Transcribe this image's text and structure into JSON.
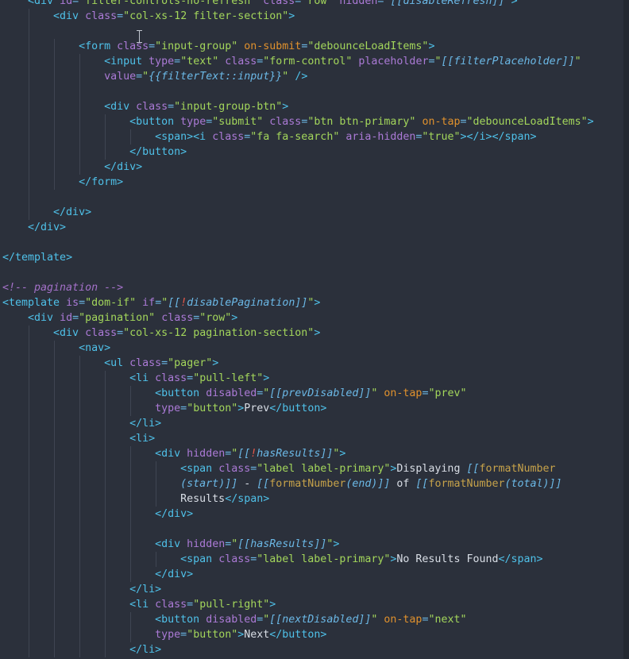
{
  "editor": {
    "lines": [
      [
        [
          "t",
          "    <div"
        ],
        [
          "w",
          " "
        ],
        [
          "a",
          "id"
        ],
        [
          "p",
          "="
        ],
        [
          "s",
          "\"filter-controls-no-refresh\""
        ],
        [
          "w",
          " "
        ],
        [
          "a",
          "class"
        ],
        [
          "p",
          "="
        ],
        [
          "s",
          "\"row\""
        ],
        [
          "w",
          " "
        ],
        [
          "a",
          "hidden"
        ],
        [
          "p",
          "="
        ],
        [
          "s",
          "\""
        ],
        [
          "i",
          "[[disableRefresh]]"
        ],
        [
          "s",
          "\""
        ],
        [
          "t",
          ">"
        ]
      ],
      [
        [
          "t",
          "        <div"
        ],
        [
          "w",
          " "
        ],
        [
          "a",
          "class"
        ],
        [
          "p",
          "="
        ],
        [
          "s",
          "\"col-xs-12 filter-section\""
        ],
        [
          "t",
          ">"
        ]
      ],
      [],
      [
        [
          "t",
          "            <form"
        ],
        [
          "w",
          " "
        ],
        [
          "a",
          "class"
        ],
        [
          "p",
          "="
        ],
        [
          "s",
          "\"input-group\""
        ],
        [
          "w",
          " "
        ],
        [
          "o",
          "on-submit"
        ],
        [
          "p",
          "="
        ],
        [
          "s",
          "\"debounceLoadItems\""
        ],
        [
          "t",
          ">"
        ]
      ],
      [
        [
          "t",
          "                <input"
        ],
        [
          "w",
          " "
        ],
        [
          "a",
          "type"
        ],
        [
          "p",
          "="
        ],
        [
          "s",
          "\"text\""
        ],
        [
          "w",
          " "
        ],
        [
          "a",
          "class"
        ],
        [
          "p",
          "="
        ],
        [
          "s",
          "\"form-control\""
        ],
        [
          "w",
          " "
        ],
        [
          "a",
          "placeholder"
        ],
        [
          "p",
          "="
        ],
        [
          "s",
          "\""
        ],
        [
          "i",
          "[[filterPlaceholder]]"
        ],
        [
          "s",
          "\""
        ]
      ],
      [
        [
          "w",
          "                "
        ],
        [
          "a",
          "value"
        ],
        [
          "p",
          "="
        ],
        [
          "s",
          "\""
        ],
        [
          "i",
          "{{filterText::input}}"
        ],
        [
          "s",
          "\""
        ],
        [
          "w",
          " "
        ],
        [
          "t",
          "/>"
        ]
      ],
      [],
      [
        [
          "t",
          "                <div"
        ],
        [
          "w",
          " "
        ],
        [
          "a",
          "class"
        ],
        [
          "p",
          "="
        ],
        [
          "s",
          "\"input-group-btn\""
        ],
        [
          "t",
          ">"
        ]
      ],
      [
        [
          "t",
          "                    <button"
        ],
        [
          "w",
          " "
        ],
        [
          "a",
          "type"
        ],
        [
          "p",
          "="
        ],
        [
          "s",
          "\"submit\""
        ],
        [
          "w",
          " "
        ],
        [
          "a",
          "class"
        ],
        [
          "p",
          "="
        ],
        [
          "s",
          "\"btn btn-primary\""
        ],
        [
          "w",
          " "
        ],
        [
          "o",
          "on-tap"
        ],
        [
          "p",
          "="
        ],
        [
          "s",
          "\"debounceLoadItems\""
        ],
        [
          "t",
          ">"
        ]
      ],
      [
        [
          "t",
          "                        <span><i"
        ],
        [
          "w",
          " "
        ],
        [
          "a",
          "class"
        ],
        [
          "p",
          "="
        ],
        [
          "s",
          "\"fa fa-search\""
        ],
        [
          "w",
          " "
        ],
        [
          "a",
          "aria-hidden"
        ],
        [
          "p",
          "="
        ],
        [
          "s",
          "\"true\""
        ],
        [
          "t",
          "></i></span>"
        ]
      ],
      [
        [
          "t",
          "                    </button>"
        ]
      ],
      [
        [
          "t",
          "                </div>"
        ]
      ],
      [
        [
          "t",
          "            </form>"
        ]
      ],
      [],
      [
        [
          "t",
          "        </div>"
        ]
      ],
      [
        [
          "t",
          "    </div>"
        ]
      ],
      [],
      [
        [
          "t",
          "</template"
        ],
        [
          "t",
          ">"
        ]
      ],
      [],
      [
        [
          "c",
          "<!-- pagination -->"
        ]
      ],
      [
        [
          "t",
          "<template"
        ],
        [
          "w",
          " "
        ],
        [
          "a",
          "is"
        ],
        [
          "p",
          "="
        ],
        [
          "s",
          "\"dom-if\""
        ],
        [
          "w",
          " "
        ],
        [
          "a",
          "if"
        ],
        [
          "p",
          "="
        ],
        [
          "s",
          "\""
        ],
        [
          "i",
          "[["
        ],
        [
          "x",
          "!"
        ],
        [
          "i",
          "disablePagination]]"
        ],
        [
          "s",
          "\""
        ],
        [
          "t",
          ">"
        ]
      ],
      [
        [
          "t",
          "    <div"
        ],
        [
          "w",
          " "
        ],
        [
          "a",
          "id"
        ],
        [
          "p",
          "="
        ],
        [
          "s",
          "\"pagination\""
        ],
        [
          "w",
          " "
        ],
        [
          "a",
          "class"
        ],
        [
          "p",
          "="
        ],
        [
          "s",
          "\"row\""
        ],
        [
          "t",
          ">"
        ]
      ],
      [
        [
          "t",
          "        <div"
        ],
        [
          "w",
          " "
        ],
        [
          "a",
          "class"
        ],
        [
          "p",
          "="
        ],
        [
          "s",
          "\"col-xs-12 pagination-section\""
        ],
        [
          "t",
          ">"
        ]
      ],
      [
        [
          "t",
          "            <nav>"
        ]
      ],
      [
        [
          "t",
          "                <ul"
        ],
        [
          "w",
          " "
        ],
        [
          "a",
          "class"
        ],
        [
          "p",
          "="
        ],
        [
          "s",
          "\"pager\""
        ],
        [
          "t",
          ">"
        ]
      ],
      [
        [
          "t",
          "                    <li"
        ],
        [
          "w",
          " "
        ],
        [
          "a",
          "class"
        ],
        [
          "p",
          "="
        ],
        [
          "s",
          "\"pull-left\""
        ],
        [
          "t",
          ">"
        ]
      ],
      [
        [
          "t",
          "                        <button"
        ],
        [
          "w",
          " "
        ],
        [
          "a",
          "disabled"
        ],
        [
          "p",
          "="
        ],
        [
          "s",
          "\""
        ],
        [
          "i",
          "[[prevDisabled]]"
        ],
        [
          "s",
          "\""
        ],
        [
          "w",
          " "
        ],
        [
          "o",
          "on-tap"
        ],
        [
          "p",
          "="
        ],
        [
          "s",
          "\"prev\""
        ]
      ],
      [
        [
          "w",
          "                        "
        ],
        [
          "a",
          "type"
        ],
        [
          "p",
          "="
        ],
        [
          "s",
          "\"button\""
        ],
        [
          "t",
          ">"
        ],
        [
          "w",
          "Prev"
        ],
        [
          "t",
          "</button>"
        ]
      ],
      [
        [
          "t",
          "                    </li>"
        ]
      ],
      [
        [
          "t",
          "                    <li>"
        ]
      ],
      [
        [
          "t",
          "                        <div"
        ],
        [
          "w",
          " "
        ],
        [
          "a",
          "hidden"
        ],
        [
          "p",
          "="
        ],
        [
          "s",
          "\""
        ],
        [
          "i",
          "[["
        ],
        [
          "x",
          "!"
        ],
        [
          "i",
          "hasResults]]"
        ],
        [
          "s",
          "\""
        ],
        [
          "t",
          ">"
        ]
      ],
      [
        [
          "t",
          "                            <span"
        ],
        [
          "w",
          " "
        ],
        [
          "a",
          "class"
        ],
        [
          "p",
          "="
        ],
        [
          "s",
          "\"label label-primary\""
        ],
        [
          "t",
          ">"
        ],
        [
          "w",
          "Displaying "
        ],
        [
          "i",
          "[["
        ],
        [
          "f",
          "formatNumber"
        ]
      ],
      [
        [
          "w",
          "                            "
        ],
        [
          "i",
          "(start)]]"
        ],
        [
          "w",
          " - "
        ],
        [
          "i",
          "[["
        ],
        [
          "f",
          "formatNumber"
        ],
        [
          "i",
          "(end)]]"
        ],
        [
          "w",
          " of "
        ],
        [
          "i",
          "[["
        ],
        [
          "f",
          "formatNumber"
        ],
        [
          "i",
          "(total)]]"
        ]
      ],
      [
        [
          "w",
          "                            Results"
        ],
        [
          "t",
          "</span>"
        ]
      ],
      [
        [
          "t",
          "                        </div>"
        ]
      ],
      [],
      [
        [
          "t",
          "                        <div"
        ],
        [
          "w",
          " "
        ],
        [
          "a",
          "hidden"
        ],
        [
          "p",
          "="
        ],
        [
          "s",
          "\""
        ],
        [
          "i",
          "[[hasResults]]"
        ],
        [
          "s",
          "\""
        ],
        [
          "t",
          ">"
        ]
      ],
      [
        [
          "t",
          "                            <span"
        ],
        [
          "w",
          " "
        ],
        [
          "a",
          "class"
        ],
        [
          "p",
          "="
        ],
        [
          "s",
          "\"label label-primary\""
        ],
        [
          "t",
          ">"
        ],
        [
          "w",
          "No Results Found"
        ],
        [
          "t",
          "</span>"
        ]
      ],
      [
        [
          "t",
          "                        </div>"
        ]
      ],
      [
        [
          "t",
          "                    </li>"
        ]
      ],
      [
        [
          "t",
          "                    <li"
        ],
        [
          "w",
          " "
        ],
        [
          "a",
          "class"
        ],
        [
          "p",
          "="
        ],
        [
          "s",
          "\"pull-right\""
        ],
        [
          "t",
          ">"
        ]
      ],
      [
        [
          "t",
          "                        <button"
        ],
        [
          "w",
          " "
        ],
        [
          "a",
          "disabled"
        ],
        [
          "p",
          "="
        ],
        [
          "s",
          "\""
        ],
        [
          "i",
          "[[nextDisabled]]"
        ],
        [
          "s",
          "\""
        ],
        [
          "w",
          " "
        ],
        [
          "o",
          "on-tap"
        ],
        [
          "p",
          "="
        ],
        [
          "s",
          "\"next\""
        ]
      ],
      [
        [
          "w",
          "                        "
        ],
        [
          "a",
          "type"
        ],
        [
          "p",
          "="
        ],
        [
          "s",
          "\"button\""
        ],
        [
          "t",
          ">"
        ],
        [
          "w",
          "Next"
        ],
        [
          "t",
          "</button>"
        ]
      ],
      [
        [
          "t",
          "                    </li>"
        ]
      ]
    ]
  },
  "theme": {
    "background": "#2b303b",
    "tag": "#4fc1e9",
    "attribute": "#ab7ad6",
    "event_attribute": "#e0912d",
    "string": "#a3d65b",
    "binding": "#6bb8e6",
    "comment": "#a471c9",
    "negation": "#e8584a",
    "text": "#d9dee6",
    "function": "#c6a24a"
  },
  "cursor_icon": "text-cursor-icon"
}
